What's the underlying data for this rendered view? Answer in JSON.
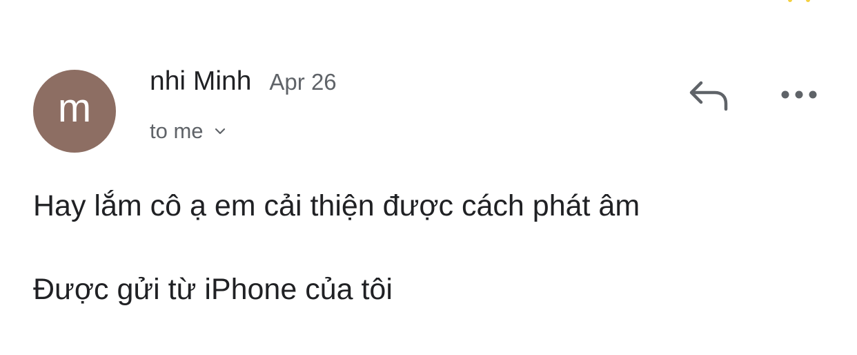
{
  "colors": {
    "avatar_bg": "#8d6e63",
    "primary_text": "#202124",
    "secondary_text": "#5f6368",
    "icon": "#5f6368",
    "accent_dots": "#f4d03f"
  },
  "message": {
    "sender": {
      "avatar_letter": "m",
      "name": "nhi Minh",
      "date": "Apr 26"
    },
    "recipient": {
      "label": "to me",
      "expand_icon": "chevron-down-icon"
    },
    "actions": {
      "reply_icon": "reply-icon",
      "more_icon": "more-horizontal-icon"
    },
    "body": {
      "text": "Hay lắm cô ạ em cải thiện được cách phát âm",
      "signature": "Được gửi từ iPhone của tôi"
    }
  }
}
